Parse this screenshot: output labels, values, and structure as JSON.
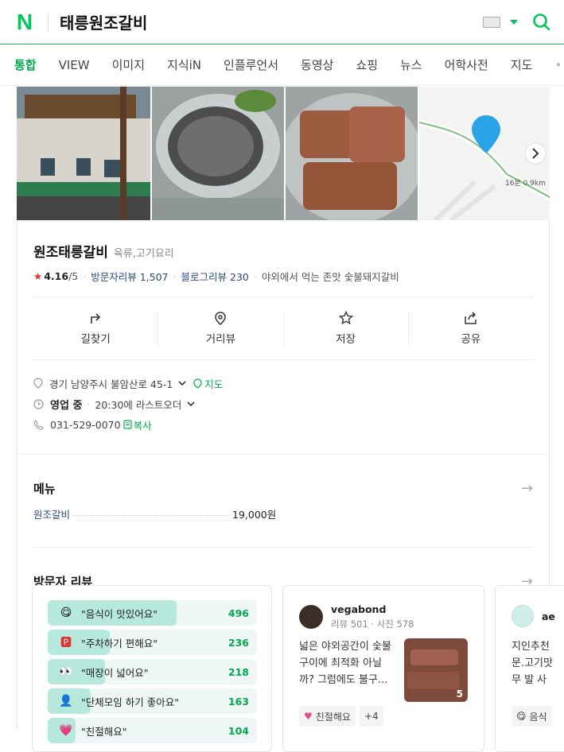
{
  "header": {
    "logo": "N",
    "query": "태릉원조갈비"
  },
  "tabs": [
    "통합",
    "VIEW",
    "이미지",
    "지식iN",
    "인플루언서",
    "동영상",
    "쇼핑",
    "뉴스",
    "어학사전",
    "지도"
  ],
  "tab_more": "•••",
  "map": {
    "label": "16분 0.9km"
  },
  "place": {
    "name": "원조태릉갈비",
    "category": "육류,고기요리",
    "rating": "4.16",
    "rating_max": "/5",
    "visitor_reviews_label": "방문자리뷰",
    "visitor_reviews_count": "1,507",
    "blog_reviews_label": "블로그리뷰",
    "blog_reviews_count": "230",
    "tagline": "야외에서 먹는 존맛 숯불돼지갈비"
  },
  "actions": [
    "길찾기",
    "거리뷰",
    "저장",
    "공유"
  ],
  "info": {
    "address": "경기 남양주시 불암산로 45-1",
    "map_link": "지도",
    "status": "영업 중",
    "last_order": "20:30에 라스트오더",
    "phone": "031-529-0070",
    "copy": "복사"
  },
  "menu": {
    "title": "메뉴",
    "items": [
      {
        "name": "원조갈비",
        "price": "19,000원"
      }
    ]
  },
  "visitor_review": {
    "title": "방문자 리뷰",
    "keywords": [
      {
        "emoji": "😋",
        "label": "\"음식이 맛있어요\"",
        "count": "496",
        "ratio": 1.0
      },
      {
        "emoji": "🅿",
        "label": "\"주차하기 편해요\"",
        "count": "236",
        "ratio": 0.476
      },
      {
        "emoji": "👀",
        "label": "\"매장이 넓어요\"",
        "count": "218",
        "ratio": 0.44
      },
      {
        "emoji": "👤",
        "label": "\"단체모임 하기 좋아요\"",
        "count": "163",
        "ratio": 0.33
      },
      {
        "emoji": "💗",
        "label": "\"친절해요\"",
        "count": "104",
        "ratio": 0.21
      }
    ],
    "review": {
      "user": "vegabond",
      "meta": "리뷰 501 · 사진 578",
      "text": "넓은 야외공간이 숯불구이에 최적화 아닐까? 그럼에도 불구...",
      "photo_count": "5",
      "chip": "친절해요",
      "chip_more": "+4"
    },
    "review2": {
      "user": "ae",
      "text": "지인추천 문.고기맛 무 발 사",
      "chip": "음식"
    }
  },
  "colors": {
    "brand": "#03c75a",
    "accent": "#03a94f",
    "link": "#2a4a7f",
    "star": "#e8332f"
  }
}
